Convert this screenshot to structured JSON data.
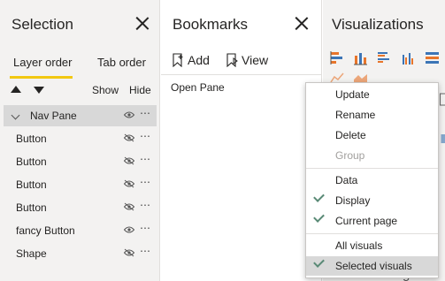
{
  "selection": {
    "title": "Selection",
    "tabs": {
      "layer_order": "Layer order",
      "tab_order": "Tab order"
    },
    "show_label": "Show",
    "hide_label": "Hide",
    "layers": [
      {
        "name": "Nav Pane",
        "type": "group",
        "visible": true,
        "selected": true
      },
      {
        "name": "Button",
        "type": "item",
        "visible": false
      },
      {
        "name": "Button",
        "type": "item",
        "visible": false
      },
      {
        "name": "Button",
        "type": "item",
        "visible": false
      },
      {
        "name": "Button",
        "type": "item",
        "visible": false
      },
      {
        "name": "fancy Button",
        "type": "item",
        "visible": true
      },
      {
        "name": "Shape",
        "type": "item",
        "visible": false
      }
    ],
    "more_glyph": "⋯"
  },
  "bookmarks": {
    "title": "Bookmarks",
    "add_label": "Add",
    "view_label": "View",
    "items": [
      "Open Pane"
    ]
  },
  "visualizations": {
    "title": "Visualizations",
    "footer_text": "Drillthrough"
  },
  "context_menu": {
    "items": [
      {
        "label": "Update",
        "checked": false,
        "disabled": false
      },
      {
        "label": "Rename",
        "checked": false,
        "disabled": false
      },
      {
        "label": "Delete",
        "checked": false,
        "disabled": false
      },
      {
        "label": "Group",
        "checked": false,
        "disabled": true
      },
      {
        "label": "Data",
        "checked": false,
        "disabled": false
      },
      {
        "label": "Display",
        "checked": true,
        "disabled": false
      },
      {
        "label": "Current page",
        "checked": true,
        "disabled": false
      },
      {
        "label": "All visuals",
        "checked": false,
        "disabled": false
      },
      {
        "label": "Selected visuals",
        "checked": true,
        "disabled": false,
        "highlighted": true
      }
    ]
  },
  "colors": {
    "accent_yellow": "#f2c811",
    "check_green": "#5a8a76",
    "viz_orange": "#e8752a",
    "viz_blue": "#3c75b6"
  }
}
